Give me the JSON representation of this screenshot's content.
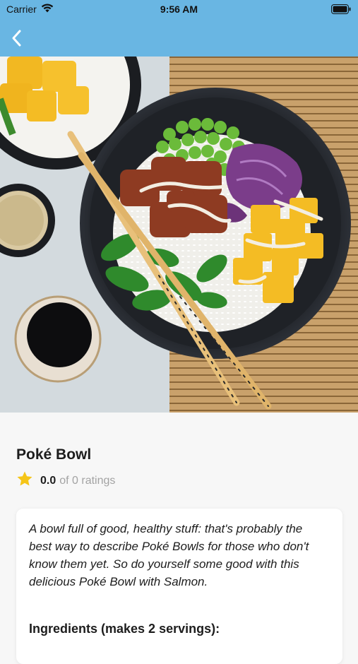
{
  "status_bar": {
    "carrier": "Carrier",
    "time": "9:56 AM",
    "icons": [
      "wifi-icon",
      "battery-icon"
    ]
  },
  "nav": {
    "back_icon": "chevron-left-icon",
    "bar_color": "#69b6e3"
  },
  "recipe": {
    "title": "Poké Bowl",
    "rating_value": "0.0",
    "rating_suffix": "of 0 ratings",
    "star_icon": "star-icon",
    "star_color": "#f5c518",
    "description": "A bowl full of good, healthy stuff: that's probably the best way to describe Poké Bowls for those who don't know them yet. So do yourself some good with this delicious Poké Bowl with Salmon.",
    "ingredients_heading": "Ingredients (makes 2 servings):"
  }
}
